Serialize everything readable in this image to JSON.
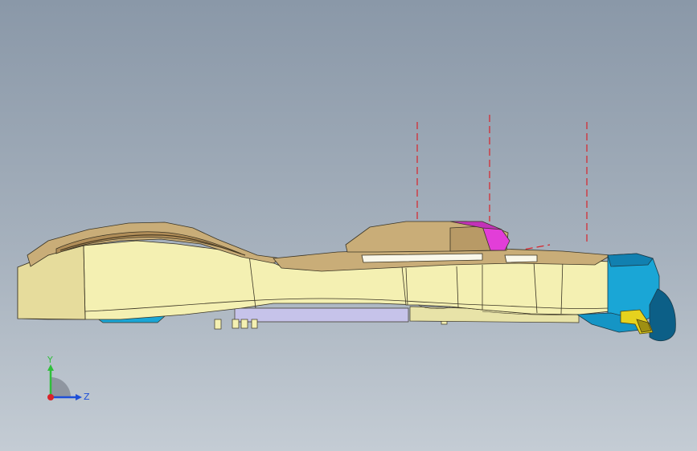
{
  "viewport": {
    "background_top": "#8a98a8",
    "background_bottom": "#c4ccd4"
  },
  "model": {
    "body_color": "#f4f0b2",
    "top_color": "#c9ad78",
    "edge_color": "#3a3424",
    "accent_magenta": "#e23ed8",
    "accent_cyan": "#1aa6d6",
    "accent_lavender": "#c6c3ea",
    "accent_yellow": "#e6d21e",
    "centerline_color": "#d9232a"
  },
  "triad": {
    "y_label": "Y",
    "z_label": "Z",
    "y_color": "#2fbf3a",
    "z_color": "#1e4fd8",
    "x_color": "#d9232a"
  }
}
